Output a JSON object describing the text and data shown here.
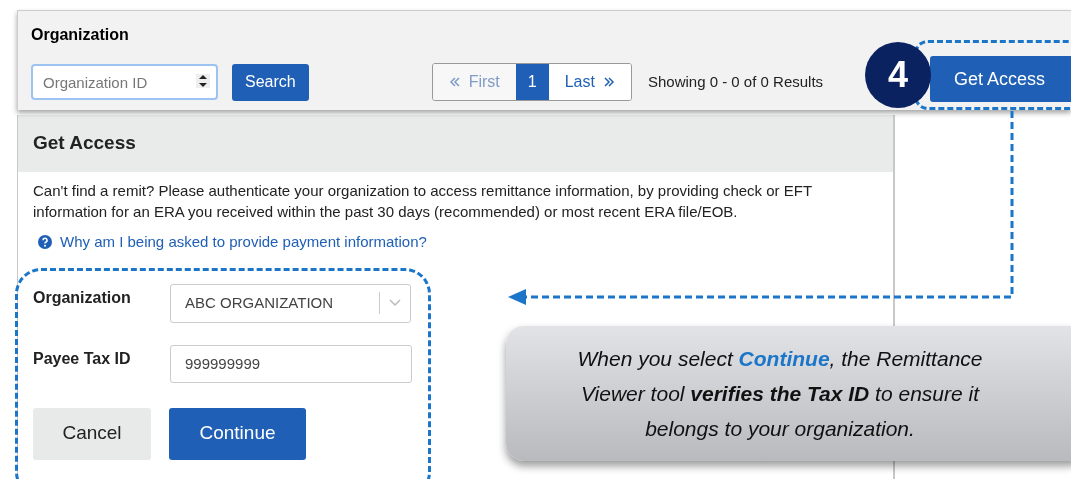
{
  "org_bar": {
    "title": "Organization",
    "id_field": {
      "placeholder": "Organization ID"
    },
    "search_button": "Search",
    "pagination": [
      {
        "label": "First",
        "kind": "first",
        "selected": false
      },
      {
        "label": "1",
        "kind": "page",
        "selected": true
      },
      {
        "label": "Last",
        "kind": "last",
        "selected": false
      }
    ],
    "results": "Showing 0 - 0 of 0 Results",
    "get_access_button": "Get Access"
  },
  "step": {
    "number": "4"
  },
  "get_access": {
    "title": "Get Access",
    "description": "Can't find a remit? Please authenticate your organization to access remittance information, by providing check or EFT information for an ERA you received within the past 30 days (recommended) or most recent ERA file/EOB.",
    "help_link": "Why am I being asked to provide payment information?",
    "fields": [
      {
        "label": "Organization",
        "kind": "select",
        "value": "ABC ORGANIZATION"
      },
      {
        "label": "Payee Tax ID",
        "kind": "text",
        "value": "999999999"
      }
    ],
    "buttons": [
      {
        "label": "Cancel",
        "kind": "secondary"
      },
      {
        "label": "Continue",
        "kind": "primary"
      }
    ]
  },
  "callout": {
    "segments": [
      {
        "text": "When you select ",
        "kind": "plain"
      },
      {
        "text": "Continue",
        "kind": "highlight"
      },
      {
        "text": ", the Remittance Viewer tool ",
        "kind": "plain"
      },
      {
        "text": "verifies the Tax ID",
        "kind": "bold"
      },
      {
        "text": " to ensure it belongs to your organization.",
        "kind": "plain"
      }
    ]
  }
}
